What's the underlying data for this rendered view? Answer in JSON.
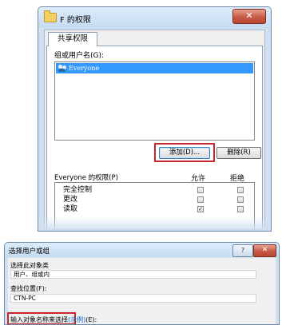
{
  "permissions_window": {
    "title": "F 的权限",
    "close_symbol": "✕",
    "tab_label": "共享权限",
    "group_label": "组或用户名(G):",
    "users": [
      {
        "name": "Everyone",
        "selected": true
      }
    ],
    "add_button_label": "添加(D)...",
    "remove_button_label": "删除(R)",
    "permissions_header": "Everyone 的权限(P)",
    "allow_header": "允许",
    "deny_header": "拒绝",
    "permissions": [
      {
        "name": "完全控制",
        "allow": false,
        "deny": false
      },
      {
        "name": "更改",
        "allow": false,
        "deny": false
      },
      {
        "name": "读取",
        "allow": true,
        "deny": false
      }
    ],
    "check_mark": "✓"
  },
  "select_dialog": {
    "title": "选择用户或组",
    "help_symbol": "?",
    "close_symbol": "✕",
    "object_type_label": "选择此对象类",
    "object_type_value": "用户、组或内",
    "location_label": "查找位置(F):",
    "location_value": "CTN-PC",
    "enter_names_label": "输入对象名称来选择",
    "examples_link": "(示例)",
    "enter_names_suffix": "(E):"
  },
  "colors": {
    "highlight_border": "#c8252c",
    "selection_blue": "#3399ff",
    "link_blue": "#0066cc"
  }
}
